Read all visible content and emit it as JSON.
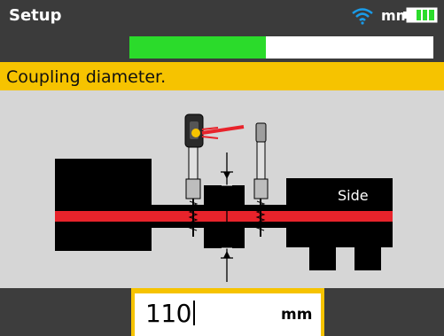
{
  "header": {
    "title": "Setup",
    "unit": "mm",
    "progress": 0.45
  },
  "icons": {
    "wifi": "wifi-icon",
    "battery": "battery-icon"
  },
  "instruction": "Coupling diameter.",
  "scene": {
    "side_label": "Side"
  },
  "input": {
    "value": "110",
    "unit": "mm"
  },
  "colors": {
    "accent": "#f6c300",
    "progress": "#2bdb2b",
    "laser": "#e8232b",
    "wifi": "#1a9be8"
  }
}
